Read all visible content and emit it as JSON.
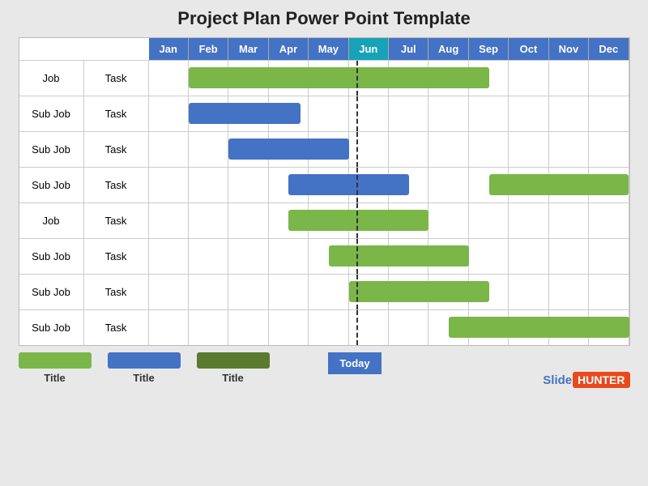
{
  "title": "Project Plan Power Point Template",
  "months": [
    "Jan",
    "Feb",
    "Mar",
    "Apr",
    "May",
    "Jun",
    "Jul",
    "Aug",
    "Sep",
    "Oct",
    "Nov",
    "Dec"
  ],
  "monthColors": [
    "blue",
    "blue",
    "blue",
    "blue",
    "blue",
    "teal",
    "blue",
    "blue",
    "blue",
    "blue",
    "blue",
    "blue"
  ],
  "rows": [
    {
      "job": "Job",
      "task": "Task",
      "barColor": "green",
      "barStart": 1,
      "barEnd": 8.5
    },
    {
      "job": "Sub Job",
      "task": "Task",
      "barColor": "blue",
      "barStart": 1,
      "barEnd": 3.8
    },
    {
      "job": "Sub Job",
      "task": "Task",
      "barColor": "blue",
      "barStart": 2,
      "barEnd": 5
    },
    {
      "job": "Sub Job",
      "task": "Task",
      "barColor": "blue",
      "barStart": 3.5,
      "barEnd": 6.5,
      "bar2Color": "green",
      "bar2Start": 8.5,
      "bar2End": 12
    },
    {
      "job": "Job",
      "task": "Task",
      "barColor": "green",
      "barStart": 3.5,
      "barEnd": 7
    },
    {
      "job": "Sub Job",
      "task": "Task",
      "barColor": "green",
      "barStart": 4.5,
      "barEnd": 8
    },
    {
      "job": "Sub Job",
      "task": "Task",
      "barColor": "green",
      "barStart": 5,
      "barEnd": 8.5
    },
    {
      "job": "Sub Job",
      "task": "Task",
      "barColor": "green",
      "barStart": 7.5,
      "barEnd": 12
    }
  ],
  "todayLabel": "Today",
  "todayPosition": 5.2,
  "legend": [
    {
      "color": "green",
      "label": "Title"
    },
    {
      "color": "blue",
      "label": "Title"
    },
    {
      "color": "darkgreen",
      "label": "Title"
    }
  ],
  "branding": {
    "slide": "Slide",
    "hunter": "HUNTER"
  }
}
